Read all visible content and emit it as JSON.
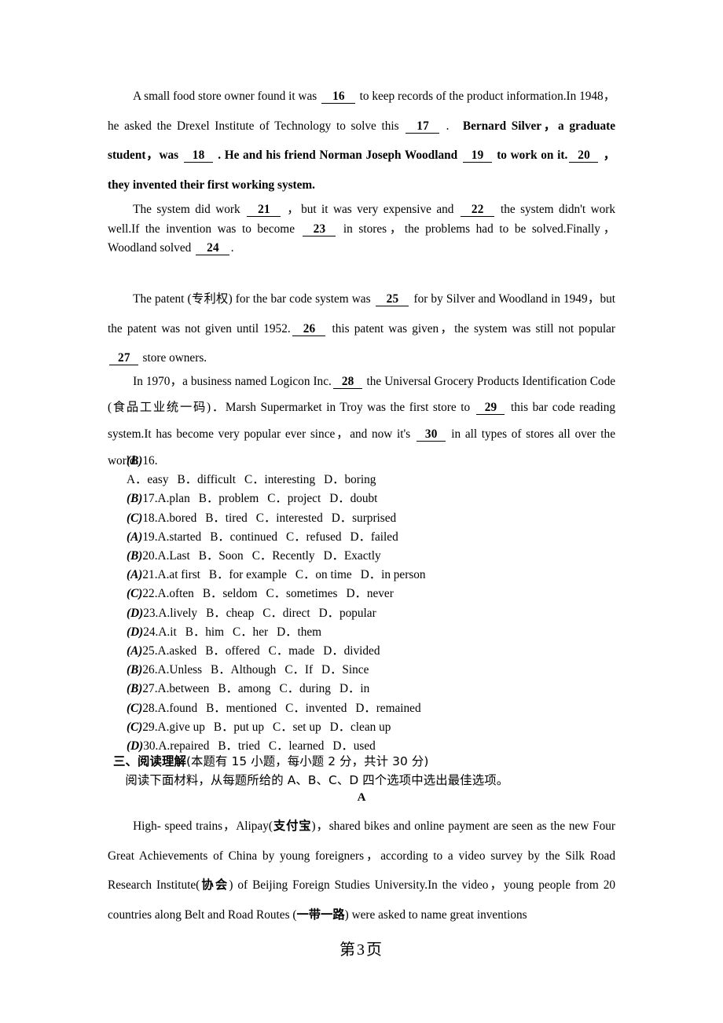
{
  "document": {
    "page_label_prefix": "第",
    "page_number": "3",
    "page_label_suffix": "页"
  },
  "cloze": {
    "paragraph1": {
      "seg1": "A small food store owner found it was",
      "blank16": "16",
      "seg2": "to keep records of the product information.In 1948，he asked the Drexel Institute of Technology to solve this",
      "blank17": "17",
      "seg3": ".",
      "bold1": "Bernard Silver，a graduate student，was",
      "blank18": "18",
      "bold2": ". He and his friend Norman Joseph Woodland",
      "blank19": "19",
      "bold3": "to work on it.",
      "blank20": "20",
      "bold4": "，they invented their first working system."
    },
    "paragraph2": {
      "seg1": "The system did work",
      "blank21": "21",
      "seg2": "，but it was very expensive and",
      "blank22": "22",
      "seg3": "the system didn't work well.If the invention was to become",
      "blank23": "23",
      "seg4": "in stores，the problems had to be solved.Finally，Woodland solved",
      "blank24": "24",
      "seg5": "."
    },
    "paragraph3": {
      "seg1": "The patent (专利权) for the bar code system was",
      "blank25": "25",
      "seg2": "for by Silver and Woodland in 1949，but the patent was not given until 1952.",
      "blank26": "26",
      "seg3": "this patent was given，the system was still not popular",
      "blank27": "27",
      "seg4": "store owners."
    },
    "paragraph4": {
      "seg1": "In 1970，a business named Logicon Inc.",
      "blank28": "28",
      "seg2": "the Universal Grocery Products Identification Code (食品工业统一码)．Marsh Supermarket in Troy was the first store to",
      "blank29": "29",
      "seg3": "this bar code reading system.It has become very popular ever since，and now it's",
      "blank30": "30",
      "seg4": "in all types of stores all over the world."
    }
  },
  "options": [
    {
      "answer": "B",
      "number": "16.",
      "stem": "",
      "choices": [
        "A．easy",
        "B．difficult",
        "C．interesting",
        "D．boring"
      ],
      "split_line": true
    },
    {
      "answer": "B",
      "number": "17.",
      "stem": "A.plan",
      "choices": [
        "B．problem",
        "C．project",
        "D．doubt"
      ],
      "split_line": false
    },
    {
      "answer": "C",
      "number": "18.",
      "stem": "A.bored",
      "choices": [
        "B．tired",
        "C．interested",
        "D．surprised"
      ],
      "split_line": false
    },
    {
      "answer": "A",
      "number": "19.",
      "stem": "A.started",
      "choices": [
        "B．continued",
        "C．refused",
        "D．failed"
      ],
      "split_line": false
    },
    {
      "answer": "B",
      "number": "20.",
      "stem": "A.Last",
      "choices": [
        "B．Soon",
        "C．Recently",
        "D．Exactly"
      ],
      "split_line": false
    },
    {
      "answer": "A",
      "number": "21.",
      "stem": "A.at first",
      "choices": [
        "B．for example",
        "C．on time",
        "D．in person"
      ],
      "split_line": false
    },
    {
      "answer": "C",
      "number": "22.",
      "stem": "A.often",
      "choices": [
        "B．seldom",
        "C．sometimes",
        "D．never"
      ],
      "split_line": false
    },
    {
      "answer": "D",
      "number": "23.",
      "stem": "A.lively",
      "choices": [
        "B．cheap",
        "C．direct",
        "D．popular"
      ],
      "split_line": false
    },
    {
      "answer": "D",
      "number": "24.",
      "stem": "A.it",
      "choices": [
        "B．him",
        "C．her",
        "D．them"
      ],
      "split_line": false
    },
    {
      "answer": "A",
      "number": "25.",
      "stem": "A.asked",
      "choices": [
        "B．offered",
        "C．made",
        "D．divided"
      ],
      "split_line": false
    },
    {
      "answer": "B",
      "number": "26.",
      "stem": "A.Unless",
      "choices": [
        "B．Although",
        "C．If",
        "D．Since"
      ],
      "split_line": false
    },
    {
      "answer": "B",
      "number": "27.",
      "stem": "A.between",
      "choices": [
        "B．among",
        "C．during",
        "D．in"
      ],
      "split_line": false
    },
    {
      "answer": "C",
      "number": "28.",
      "stem": "A.found",
      "choices": [
        "B．mentioned",
        "C．invented",
        "D．remained"
      ],
      "split_line": false
    },
    {
      "answer": "C",
      "number": "29.",
      "stem": "A.give up",
      "choices": [
        "B．put up",
        "C．set up",
        "D．clean up"
      ],
      "split_line": false
    },
    {
      "answer": "D",
      "number": "30.",
      "stem": "A.repaired",
      "choices": [
        "B．tried",
        "C．learned",
        "D．used"
      ],
      "split_line": false
    }
  ],
  "section": {
    "heading_bold": "三、阅读理解",
    "heading_norm": "(本题有 15 小题，每小题 2 分，共计 30 分)",
    "instruction": "阅读下面材料，从每题所给的 A、B、C、D 四个选项中选出最佳选项。",
    "letter": "A"
  },
  "reading": {
    "para1_a": "High- speed trains，Alipay(",
    "para1_cjk1": "支付宝",
    "para1_b": ")，shared bikes and online payment are seen as the new Four Great Achievements of China by young foreigners，according to a video survey by the Silk Road Research Institute(",
    "para1_cjk2": "协会",
    "para1_c": ") of Beijing Foreign Studies University.In the video，young people from 20 countries along Belt and Road Routes (",
    "para1_cjk3": "一带一路",
    "para1_d": ") were asked to name great inventions"
  }
}
